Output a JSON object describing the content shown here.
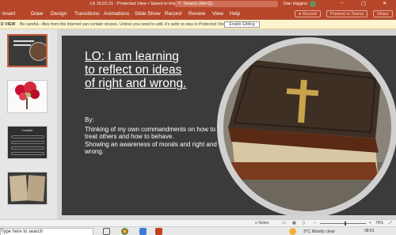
{
  "titlebar": {
    "document_title": "L6 15.01.21 - Protected View • Saved to this PC",
    "search_placeholder": "Search (Alt+Q)",
    "user_name": "Dan Higgins"
  },
  "ribbon": {
    "tabs": [
      "Insert",
      "Draw",
      "Design",
      "Transitions",
      "Animations",
      "Slide Show",
      "Record",
      "Review",
      "View",
      "Help"
    ],
    "record_button": "Record",
    "present_teams_button": "Present in Teams",
    "share_button": "Share"
  },
  "protected_view": {
    "label": "D VIEW",
    "message": "Be careful—files from the Internet can contain viruses. Unless you need to edit, it's safer to stay in Protected View.",
    "enable_button": "Enable Editing"
  },
  "slide": {
    "title_lines": [
      "LO: I am learning",
      "to reflect on ideas",
      "of right and wrong."
    ],
    "by_label": "By:",
    "points": [
      "Thinking of my own commandments on how to treat others and how to behave.",
      "Showing an awareness of morals and right and wrong."
    ]
  },
  "thumbnails": [
    {
      "selected": true
    },
    {
      "selected": false
    },
    {
      "selected": false,
      "heading": "Consider"
    },
    {
      "selected": false
    }
  ],
  "statusbar": {
    "notes_label": "Notes",
    "zoom": "76%",
    "zoom_fraction": 0.55
  },
  "taskbar": {
    "search_placeholder": "Type here to search",
    "weather": "3°C  Mostly clear",
    "time": "08:01"
  },
  "colors": {
    "ribbon": "#b7472a",
    "slide_bg": "#3b3b3b",
    "protected_bar": "#fff4ce"
  }
}
